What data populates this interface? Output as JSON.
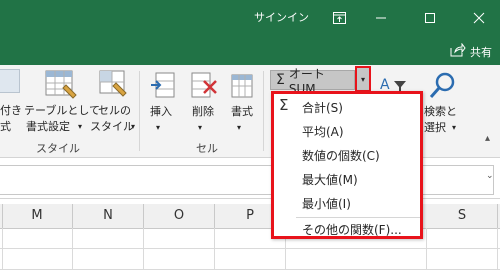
{
  "titlebar": {
    "signin": "サインイン",
    "share": "共有",
    "bg_color": "#217346"
  },
  "ribbon": {
    "partial_labels": [
      "付き",
      "式"
    ],
    "table_format": [
      "テーブルとして",
      "書式設定"
    ],
    "cell_style": [
      "セルの",
      "スタイル"
    ],
    "insert": "挿入",
    "delete": "削除",
    "format": "書式",
    "find_select": [
      "検索と",
      "選択"
    ],
    "groups": {
      "style": "スタイル",
      "cells": "セル"
    }
  },
  "autosum": {
    "icon": "Σ",
    "label": "オート SUM",
    "arrow": "▾"
  },
  "menu": {
    "items": [
      "合計(S)",
      "平均(A)",
      "数値の個数(C)",
      "最大値(M)",
      "最小値(I)",
      "その他の関数(F)..."
    ],
    "highlight_color": "#e8131b"
  },
  "columns": [
    "M",
    "N",
    "O",
    "P",
    "S"
  ]
}
